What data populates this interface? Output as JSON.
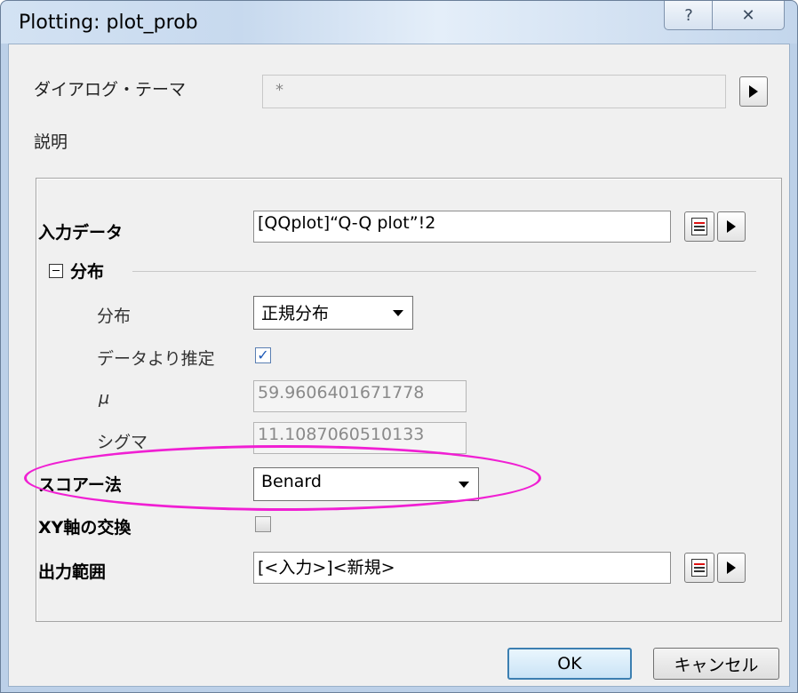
{
  "window": {
    "title": "Plotting: plot_prob",
    "help_glyph": "?",
    "close_glyph": "✕"
  },
  "theme": {
    "label": "ダイアログ・テーマ",
    "value": "*"
  },
  "description_label": "説明",
  "input": {
    "label": "入力データ",
    "value": "[QQplot]“Q-Q plot”!2"
  },
  "distribution_group": {
    "label": "分布",
    "dist_label": "分布",
    "dist_value": "正規分布",
    "estimate_label": "データより推定",
    "estimate_checked": true,
    "mu_label": "μ",
    "mu_value": "59.9606401671778",
    "sigma_label": "シグマ",
    "sigma_value": "11.1087060510133"
  },
  "score": {
    "label": "スコアー法",
    "value": "Benard"
  },
  "swap_xy": {
    "label": "XY軸の交換",
    "checked": false
  },
  "output": {
    "label": "出力範囲",
    "value": "[<入力>]<新規>"
  },
  "buttons": {
    "ok": "OK",
    "cancel": "キャンセル"
  },
  "colors": {
    "highlight": "#f01fd3",
    "check": "#1e5ab8"
  },
  "icons": {
    "expand": "triangle-right-icon",
    "collapse": "minus-box-icon",
    "pick": "select-range-icon",
    "check": "checkmark-icon"
  }
}
